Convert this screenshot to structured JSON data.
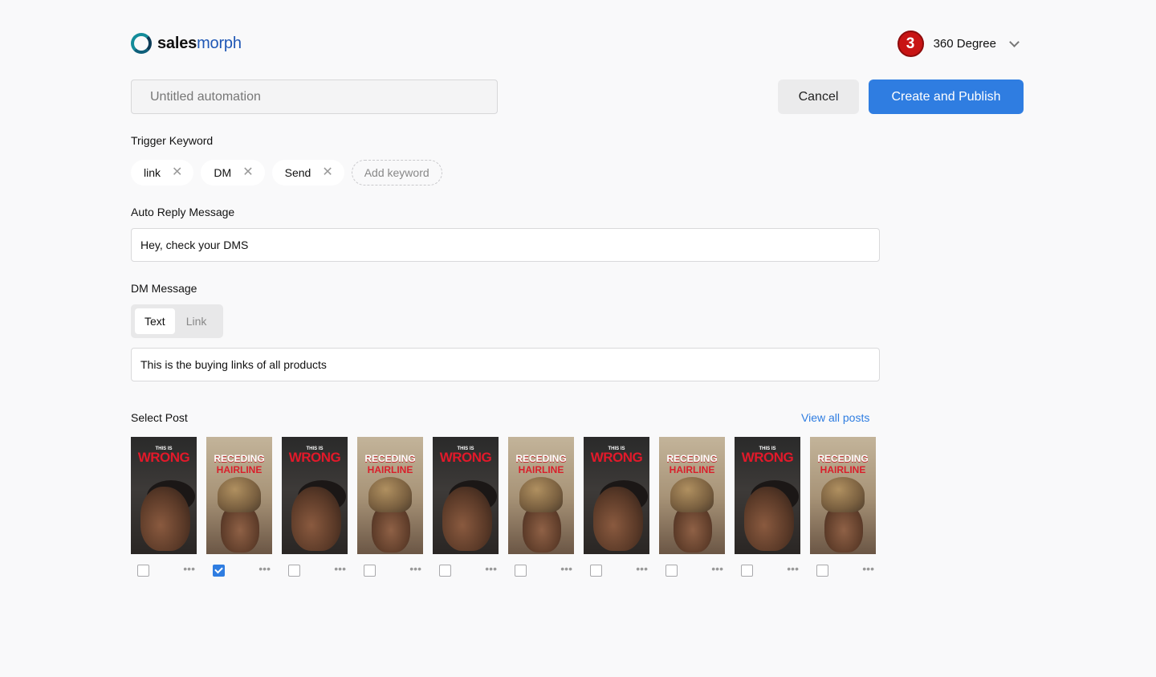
{
  "brand": {
    "name_bold": "sales",
    "name_light": "morph"
  },
  "account": {
    "avatar_text": "3",
    "name": "360 Degree"
  },
  "automation": {
    "placeholder": "Untitled automation"
  },
  "actions": {
    "cancel_label": "Cancel",
    "publish_label": "Create and Publish"
  },
  "trigger": {
    "label": "Trigger Keyword",
    "keywords": [
      "link",
      "DM",
      "Send"
    ],
    "add_placeholder": "Add keyword"
  },
  "auto_reply": {
    "label": "Auto Reply Message",
    "value": "Hey, check your DMS"
  },
  "dm": {
    "label": "DM Message",
    "tabs": [
      "Text",
      "Link"
    ],
    "active_tab": "Text",
    "value": "This is the buying links of all products"
  },
  "posts": {
    "label": "Select Post",
    "view_all": "View all posts",
    "items": [
      {
        "style": "wrong",
        "small": "THIS IS",
        "big": "WRONG",
        "checked": false
      },
      {
        "style": "recede",
        "big": "RECEDING",
        "big2": "HAIRLINE",
        "checked": true
      },
      {
        "style": "wrong",
        "small": "THIS IS",
        "big": "WRONG",
        "checked": false
      },
      {
        "style": "recede",
        "big": "RECEDING",
        "big2": "HAIRLINE",
        "checked": false
      },
      {
        "style": "wrong",
        "small": "THIS IS",
        "big": "WRONG",
        "checked": false
      },
      {
        "style": "recede",
        "big": "RECEDING",
        "big2": "HAIRLINE",
        "checked": false
      },
      {
        "style": "wrong",
        "small": "THIS IS",
        "big": "WRONG",
        "checked": false
      },
      {
        "style": "recede",
        "big": "RECEDING",
        "big2": "HAIRLINE",
        "checked": false
      },
      {
        "style": "wrong",
        "small": "THIS IS",
        "big": "WRONG",
        "checked": false
      },
      {
        "style": "recede",
        "big": "RECEDING",
        "big2": "HAIRLINE",
        "checked": false
      }
    ]
  },
  "colors": {
    "accent": "#2f7de1",
    "avatar": "#c81414",
    "brand_teal": "#138c9a"
  }
}
